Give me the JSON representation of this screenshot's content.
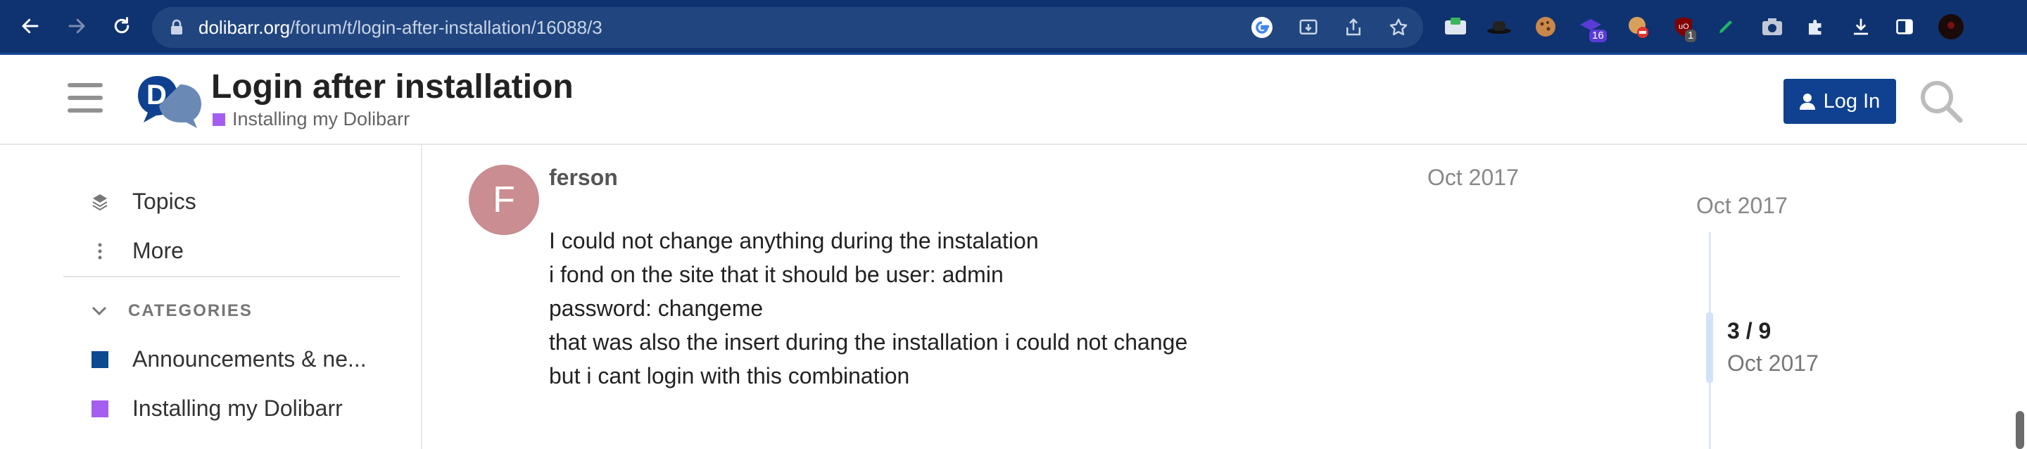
{
  "browser": {
    "url_host": "dolibarr.org",
    "url_path": "/forum/t/login-after-installation/16088/3",
    "ext_badge_a": "16",
    "ext_badge_b": "1"
  },
  "header": {
    "title": "Login after installation",
    "category": "Installing my Dolibarr",
    "category_color": "#a55ff0",
    "login_label": "Log In",
    "accent": "#0f4190"
  },
  "sidebar": {
    "topics_label": "Topics",
    "more_label": "More",
    "categories_heading": "CATEGORIES",
    "categories": [
      {
        "label": "Announcements & ne...",
        "color": "#0e4891"
      },
      {
        "label": "Installing my Dolibarr",
        "color": "#a55ff0"
      }
    ]
  },
  "post": {
    "avatar_letter": "F",
    "avatar_color": "#c98d92",
    "username": "ferson",
    "date": "Oct 2017",
    "lines": [
      "I could not change anything during the instalation",
      "i fond on the site that it should be user: admin",
      "password: changeme",
      "that was also the insert during the installation i could not change",
      "but i cant login with this combination"
    ]
  },
  "timeline": {
    "top_date": "Oct 2017",
    "position": "3 / 9",
    "current_date": "Oct 2017"
  }
}
